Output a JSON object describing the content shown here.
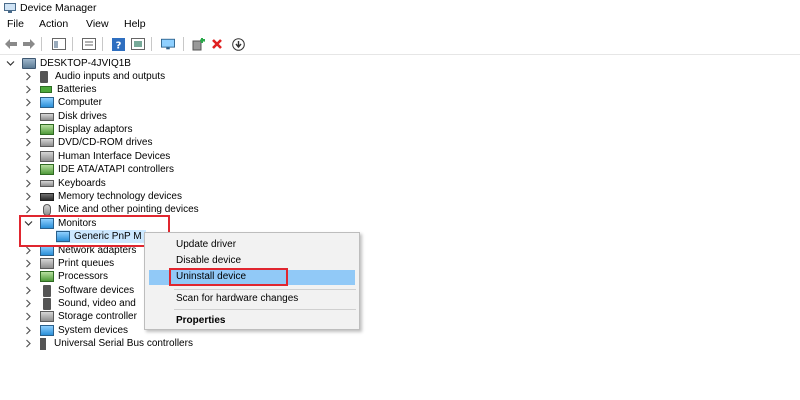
{
  "window": {
    "title": "Device Manager"
  },
  "menu": [
    "File",
    "Action",
    "View",
    "Help"
  ],
  "toolbar": {
    "icons": [
      "back-arrow-icon",
      "forward-arrow-icon",
      "show-hide-tree-icon",
      "properties-icon",
      "help-icon",
      "view-icon",
      "monitor-scan-icon",
      "add-driver-icon",
      "remove-icon",
      "download-icon"
    ]
  },
  "tree": {
    "root": "DESKTOP-4JVIQ1B",
    "items": [
      {
        "label": "Audio inputs and outputs",
        "icon": "speaker-icon"
      },
      {
        "label": "Batteries",
        "icon": "battery-icon"
      },
      {
        "label": "Computer",
        "icon": "computer-icon"
      },
      {
        "label": "Disk drives",
        "icon": "disk-drive-icon"
      },
      {
        "label": "Display adaptors",
        "icon": "display-adapter-icon"
      },
      {
        "label": "DVD/CD-ROM drives",
        "icon": "dvd-drive-icon"
      },
      {
        "label": "Human Interface Devices",
        "icon": "hid-icon"
      },
      {
        "label": "IDE ATA/ATAPI controllers",
        "icon": "ide-controller-icon"
      },
      {
        "label": "Keyboards",
        "icon": "keyboard-icon"
      },
      {
        "label": "Memory technology devices",
        "icon": "memory-icon"
      },
      {
        "label": "Mice and other pointing devices",
        "icon": "mouse-icon"
      },
      {
        "label": "Monitors",
        "icon": "monitor-icon",
        "expanded": true
      },
      {
        "label": "Generic PnP M",
        "icon": "monitor-icon",
        "child": true,
        "selected": true
      },
      {
        "label": "Network adapters",
        "icon": "network-adapter-icon"
      },
      {
        "label": "Print queues",
        "icon": "printer-icon"
      },
      {
        "label": "Processors",
        "icon": "processor-icon"
      },
      {
        "label": "Software devices",
        "icon": "software-device-icon"
      },
      {
        "label": "Sound, video and",
        "icon": "sound-icon"
      },
      {
        "label": "Storage controller",
        "icon": "storage-icon"
      },
      {
        "label": "System devices",
        "icon": "system-device-icon"
      },
      {
        "label": "Universal Serial Bus controllers",
        "icon": "usb-icon"
      }
    ]
  },
  "context_menu": {
    "items": [
      "Update driver",
      "Disable device",
      "Uninstall device",
      "Scan for hardware changes",
      "Properties"
    ],
    "highlighted": "Uninstall device"
  },
  "colors": {
    "highlight": "#91c9f7",
    "annotation_red": "#e0262f",
    "selection": "#cce8ff"
  }
}
